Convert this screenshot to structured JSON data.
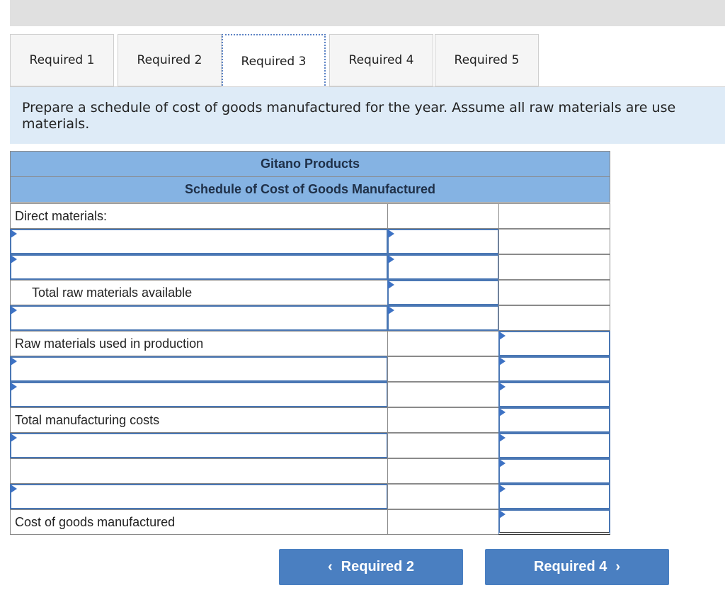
{
  "tabs": [
    {
      "label": "Required 1"
    },
    {
      "label": "Required 2"
    },
    {
      "label": "Required 3"
    },
    {
      "label": "Required 4"
    },
    {
      "label": "Required 5"
    }
  ],
  "active_tab": "Required 3",
  "instruction": {
    "line1": "Prepare a schedule of cost of goods manufactured for the year. Assume all raw materials are use",
    "line2": "materials."
  },
  "table": {
    "company": "Gitano Products",
    "title": "Schedule of Cost of Goods Manufactured",
    "labels": {
      "direct_materials": "Direct materials:",
      "total_raw": "Total raw materials available",
      "raw_used": "Raw materials used in production",
      "total_mfg": "Total manufacturing costs",
      "cogm": "Cost of goods manufactured"
    }
  },
  "nav": {
    "prev_label": "Required 2",
    "next_label": "Required 4",
    "prev_arrow": "‹",
    "next_arrow": "›"
  }
}
